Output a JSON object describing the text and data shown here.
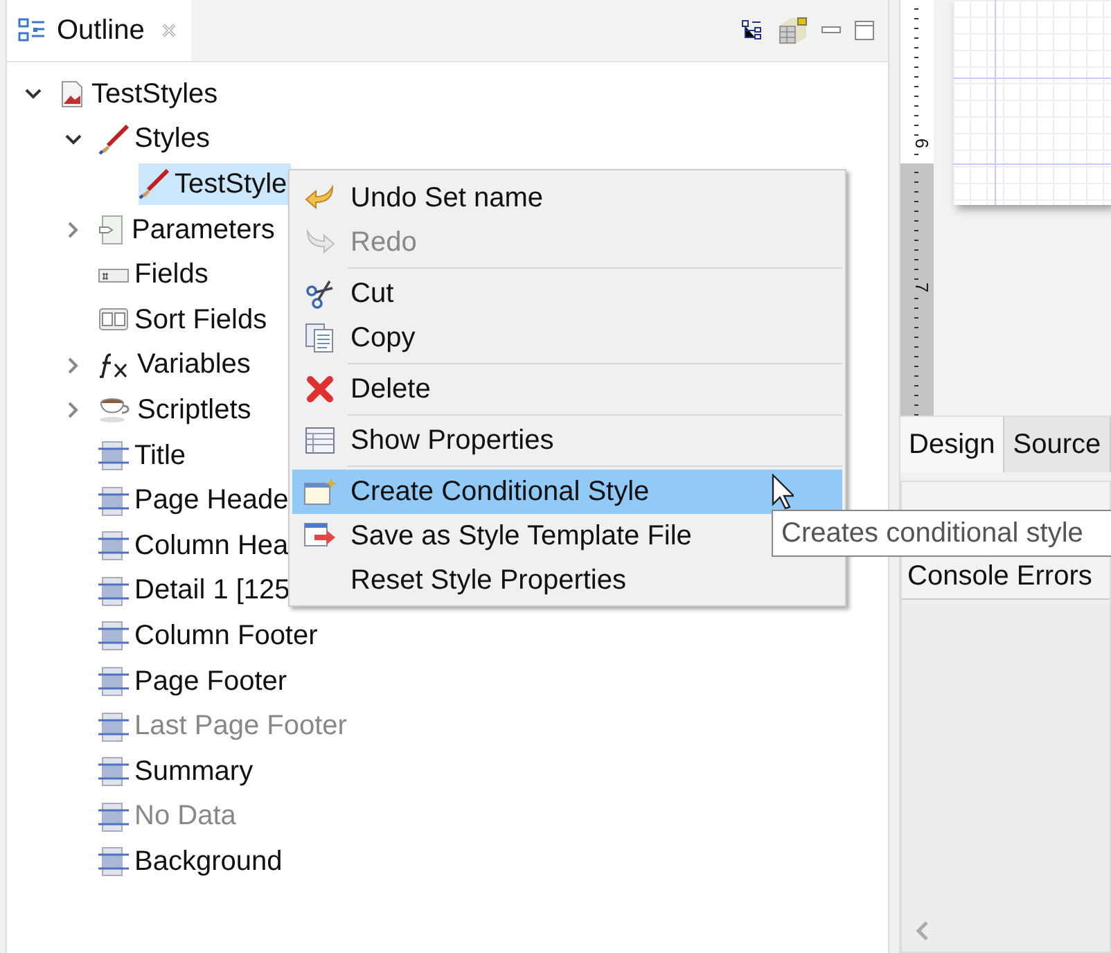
{
  "outline": {
    "title": "Outline",
    "tree": [
      {
        "label": "TestStyles",
        "kind": "report",
        "expanded": true,
        "disabled": false,
        "selected": false,
        "children": [
          {
            "label": "Styles",
            "kind": "style",
            "expanded": true,
            "disabled": false,
            "selected": false,
            "children": [
              {
                "label": "TestStyle",
                "kind": "style",
                "disabled": false,
                "selected": true
              }
            ]
          },
          {
            "label": "Parameters",
            "kind": "parameters",
            "expanded": false,
            "disabled": false,
            "selected": false
          },
          {
            "label": "Fields",
            "kind": "fields",
            "disabled": false,
            "selected": false
          },
          {
            "label": "Sort Fields",
            "kind": "sort",
            "disabled": false,
            "selected": false
          },
          {
            "label": "Variables",
            "kind": "variables",
            "expanded": false,
            "disabled": false,
            "selected": false
          },
          {
            "label": "Scriptlets",
            "kind": "scriptlets",
            "expanded": false,
            "disabled": false,
            "selected": false
          },
          {
            "label": "Title",
            "kind": "band",
            "disabled": false,
            "selected": false
          },
          {
            "label": "Page Heade",
            "kind": "band",
            "disabled": false,
            "selected": false
          },
          {
            "label": "Column Hea",
            "kind": "band",
            "disabled": false,
            "selected": false
          },
          {
            "label": "Detail 1 [125",
            "kind": "band",
            "disabled": false,
            "selected": false
          },
          {
            "label": "Column Footer",
            "kind": "band",
            "disabled": false,
            "selected": false
          },
          {
            "label": "Page Footer",
            "kind": "band",
            "disabled": false,
            "selected": false
          },
          {
            "label": "Last Page Footer",
            "kind": "band",
            "disabled": true,
            "selected": false
          },
          {
            "label": "Summary",
            "kind": "band",
            "disabled": false,
            "selected": false
          },
          {
            "label": "No Data",
            "kind": "band",
            "disabled": true,
            "selected": false
          },
          {
            "label": "Background",
            "kind": "band",
            "disabled": false,
            "selected": false
          }
        ]
      }
    ]
  },
  "context_menu": {
    "groups": [
      [
        {
          "label": "Undo Set name",
          "kind": "undo",
          "disabled": false,
          "selected": false
        },
        {
          "label": "Redo",
          "kind": "redo",
          "disabled": true,
          "selected": false
        }
      ],
      [
        {
          "label": "Cut",
          "kind": "cut",
          "disabled": false,
          "selected": false
        },
        {
          "label": "Copy",
          "kind": "copy",
          "disabled": false,
          "selected": false
        }
      ],
      [
        {
          "label": "Delete",
          "kind": "delete",
          "disabled": false,
          "selected": false
        }
      ],
      [
        {
          "label": "Show Properties",
          "kind": "properties",
          "disabled": false,
          "selected": false
        }
      ],
      [
        {
          "label": "Create Conditional Style",
          "kind": "conditional",
          "disabled": false,
          "selected": true
        },
        {
          "label": "Save as Style Template File",
          "kind": "save",
          "disabled": false,
          "selected": false
        },
        {
          "label": "Reset Style Properties",
          "kind": "plain",
          "disabled": false,
          "selected": false
        }
      ]
    ]
  },
  "tooltip": "Creates conditional style",
  "ruler_labels": [
    "6",
    "7"
  ],
  "editor_tabs": [
    {
      "label": "Design",
      "selected": true
    },
    {
      "label": "Source",
      "selected": false
    }
  ],
  "bottom_panel": {
    "label": "Console Errors"
  }
}
